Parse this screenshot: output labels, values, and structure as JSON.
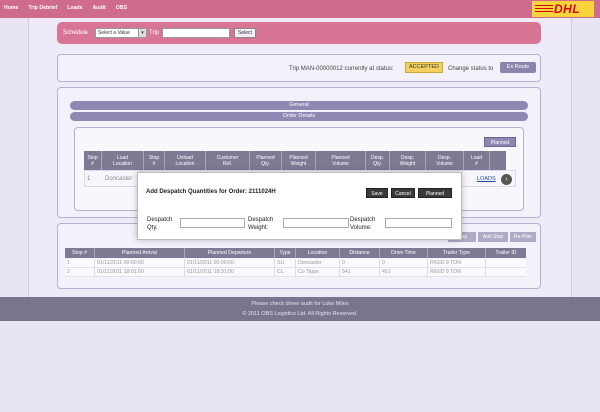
{
  "nav": {
    "items": [
      "Home",
      "Trip Debrief",
      "Loads",
      "Audit",
      "OBS"
    ]
  },
  "brand": {
    "logo_text": "DHL",
    "color_yellow": "#f7d43c",
    "color_red": "#d40511"
  },
  "schedule": {
    "schedule_label": "Schedule",
    "select_value": "Select a Value",
    "trip_label": "Trip",
    "trip_value": "",
    "select_button": "Select"
  },
  "status": {
    "text": "Trip MAN-00000012 currently at status:",
    "status_value": "ACCEPTED",
    "change_label": "Change status to",
    "change_button": "Ex Route"
  },
  "sections": {
    "general": "General",
    "order_details": "Order Details"
  },
  "order_table": {
    "planned_button": "Planned",
    "headers": [
      {
        "line1": "Stop",
        "line2": "#"
      },
      {
        "line1": "Load",
        "line2": "Location"
      },
      {
        "line1": "Stop",
        "line2": "#"
      },
      {
        "line1": "Unload",
        "line2": "Location"
      },
      {
        "line1": "Customer",
        "line2": "Ref."
      },
      {
        "line1": "Planned",
        "line2": "Qty."
      },
      {
        "line1": "Planned",
        "line2": "Weight"
      },
      {
        "line1": "Planned",
        "line2": "Volume"
      },
      {
        "line1": "Desp.",
        "line2": "Qty."
      },
      {
        "line1": "Desp.",
        "line2": "Weight"
      },
      {
        "line1": "Desp.",
        "line2": "Volume"
      },
      {
        "line1": "Load",
        "line2": "#"
      }
    ],
    "row": {
      "stop": "1",
      "load_location": "Doncaster",
      "loads_link": "LOADS"
    }
  },
  "stops": {
    "buttons": [
      "Stop",
      "Add Stop",
      "Re-Plan"
    ],
    "headers": [
      "Stop #",
      "Planned Arrival",
      "Planned Departure",
      "Type",
      "Location",
      "Distance",
      "Drive Time",
      "Trailer Type",
      "Trailer ID"
    ],
    "rows": [
      [
        "1",
        "01/11/2011 00:00:00",
        "01/11/2011 00:00:00",
        "SU",
        "Doncaster",
        "0",
        "0",
        "RIGID 9 TON",
        ""
      ],
      [
        "2",
        "01/11/2011 18:01:00",
        "01/11/2011 18:31:00",
        "CL",
        "Co Tipps",
        "541",
        "451",
        "RIGID 9 TON",
        ""
      ]
    ]
  },
  "modal": {
    "title": "Add Despatch Quantities for Order: 2111024H",
    "save": "Save",
    "cancel": "Cancel",
    "planned": "Planned",
    "qty_label": "Despatch Qty.",
    "weight_label": "Despatch Weight:",
    "volume_label": "Despatch Volume:"
  },
  "footer": {
    "audit_msg": "Please check driver audit for Luke Miles",
    "copyright": "© 2011 OBS Logistics Ltd. All Rights Reserved."
  }
}
